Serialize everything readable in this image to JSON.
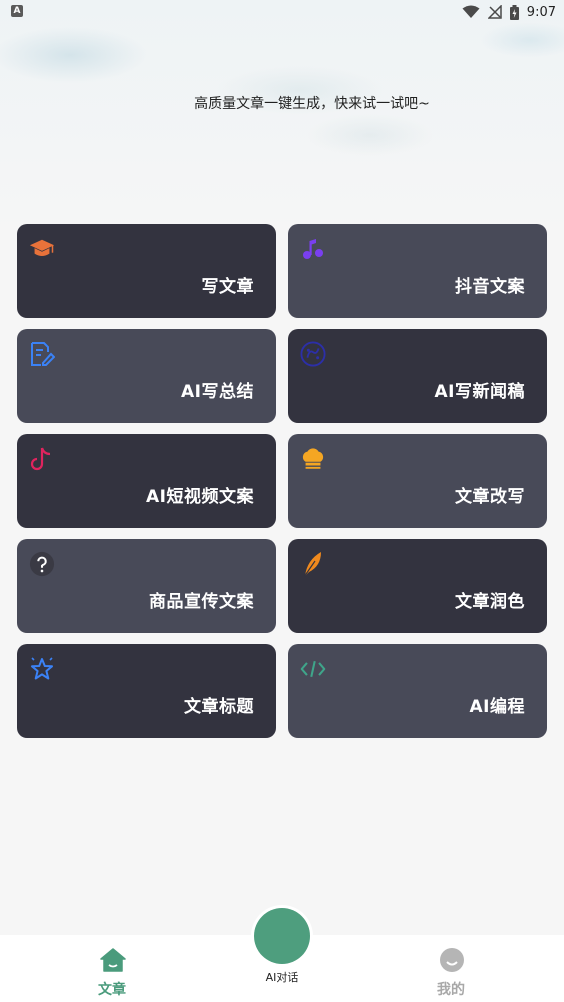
{
  "status_bar": {
    "left_icon": "A",
    "time": "9:07",
    "icons": [
      "wifi-icon",
      "no-signal-icon",
      "battery-icon"
    ]
  },
  "headline": "高质量文章一键生成，快来试一试吧~",
  "cards": [
    {
      "label": "写文章",
      "icon": "graduation-cap-icon",
      "icon_color": "#e8723a",
      "shade": "dark"
    },
    {
      "label": "抖音文案",
      "icon": "music-note-icon",
      "icon_color": "#7a3ff0",
      "shade": "light"
    },
    {
      "label": "AI写总结",
      "icon": "document-edit-icon",
      "icon_color": "#3b82f6",
      "shade": "light"
    },
    {
      "label": "AI写新闻稿",
      "icon": "news-circle-icon",
      "icon_color": "#2c2fa8",
      "shade": "dark"
    },
    {
      "label": "AI短视频文案",
      "icon": "tiktok-icon",
      "icon_color": "#e0245e",
      "shade": "dark"
    },
    {
      "label": "文章改写",
      "icon": "chef-hat-icon",
      "icon_color": "#f5a623",
      "shade": "light"
    },
    {
      "label": "商品宣传文案",
      "icon": "question-icon",
      "icon_color": "#e8e8e8",
      "shade": "light"
    },
    {
      "label": "文章润色",
      "icon": "feather-icon",
      "icon_color": "#f08a1e",
      "shade": "dark"
    },
    {
      "label": "文章标题",
      "icon": "star-icon",
      "icon_color": "#3b82f6",
      "shade": "dark"
    },
    {
      "label": "AI编程",
      "icon": "code-icon",
      "icon_color": "#3fa58a",
      "shade": "light"
    }
  ],
  "bottom_nav": {
    "home_label": "文章",
    "center_label": "AI对话",
    "mine_label": "我的",
    "active_color": "#4a9b7c",
    "inactive_color": "#a8a8a8"
  }
}
